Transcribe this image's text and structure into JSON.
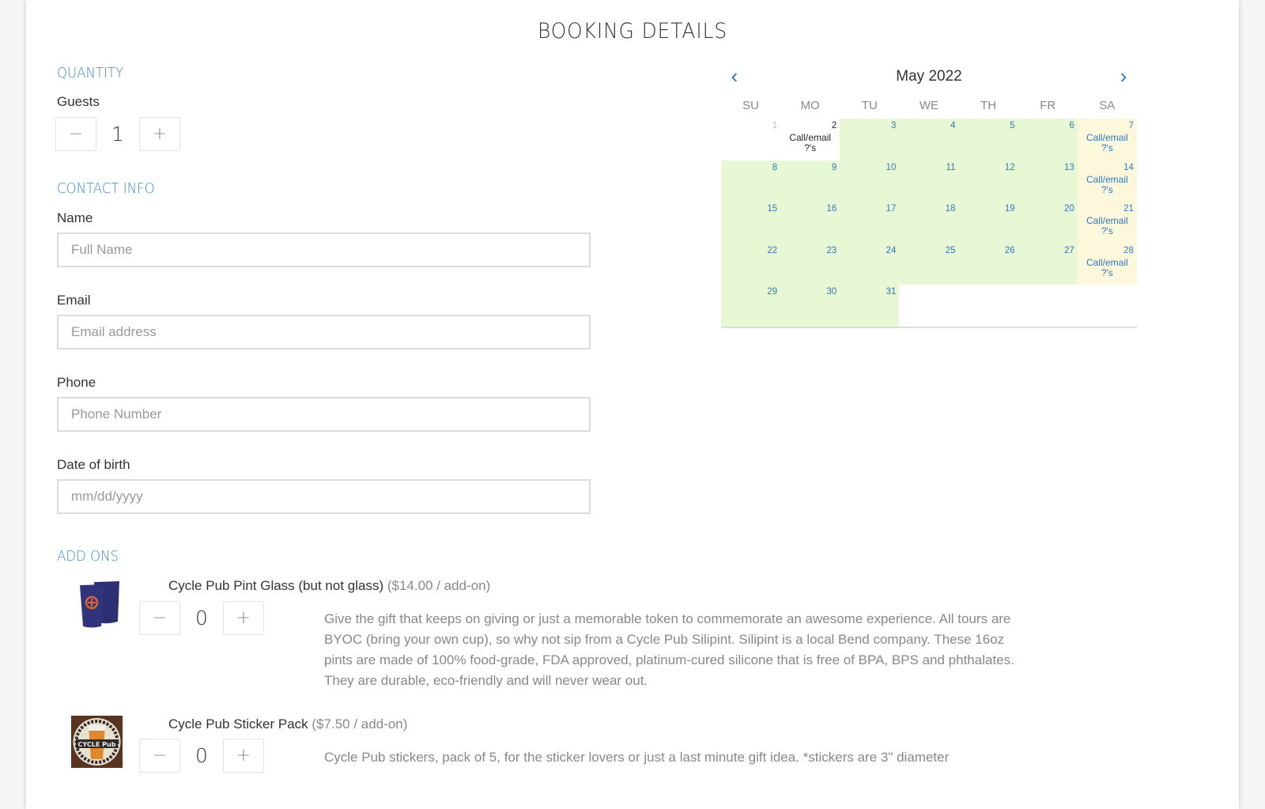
{
  "page": {
    "title": "BOOKING DETAILS"
  },
  "quantity": {
    "heading": "QUANTITY",
    "guests_label": "Guests",
    "guests_value": "1",
    "minus": "−",
    "plus": "+"
  },
  "contact": {
    "heading": "CONTACT INFO",
    "fields": [
      {
        "label": "Name",
        "placeholder": "Full Name",
        "value": ""
      },
      {
        "label": "Email",
        "placeholder": "Email address",
        "value": ""
      },
      {
        "label": "Phone",
        "placeholder": "Phone Number",
        "value": ""
      },
      {
        "label": "Date of birth",
        "placeholder": "mm/dd/yyyy",
        "value": ""
      }
    ]
  },
  "calendar": {
    "month_label": "May 2022",
    "prev_icon": "chevron-left-icon",
    "next_icon": "chevron-right-icon",
    "prev_glyph": "‹",
    "next_glyph": "›",
    "weekdays": [
      "SU",
      "MO",
      "TU",
      "WE",
      "TH",
      "FR",
      "SA"
    ],
    "note_text": "Call/email ?'s",
    "colors": {
      "available": "#e8f7d4",
      "call": "#fdf8dc",
      "link": "#2a7ac4"
    },
    "days": [
      {
        "day": "1",
        "status": "past"
      },
      {
        "day": "2",
        "status": "today",
        "note": "Call/email ?'s"
      },
      {
        "day": "3",
        "status": "avail"
      },
      {
        "day": "4",
        "status": "avail"
      },
      {
        "day": "5",
        "status": "avail"
      },
      {
        "day": "6",
        "status": "avail"
      },
      {
        "day": "7",
        "status": "call",
        "note": "Call/email ?'s"
      },
      {
        "day": "8",
        "status": "avail"
      },
      {
        "day": "9",
        "status": "avail"
      },
      {
        "day": "10",
        "status": "avail"
      },
      {
        "day": "11",
        "status": "avail"
      },
      {
        "day": "12",
        "status": "avail"
      },
      {
        "day": "13",
        "status": "avail"
      },
      {
        "day": "14",
        "status": "call",
        "note": "Call/email ?'s"
      },
      {
        "day": "15",
        "status": "avail"
      },
      {
        "day": "16",
        "status": "avail"
      },
      {
        "day": "17",
        "status": "avail"
      },
      {
        "day": "18",
        "status": "avail"
      },
      {
        "day": "19",
        "status": "avail"
      },
      {
        "day": "20",
        "status": "avail"
      },
      {
        "day": "21",
        "status": "call",
        "note": "Call/email ?'s"
      },
      {
        "day": "22",
        "status": "avail"
      },
      {
        "day": "23",
        "status": "avail"
      },
      {
        "day": "24",
        "status": "avail"
      },
      {
        "day": "25",
        "status": "avail"
      },
      {
        "day": "26",
        "status": "avail"
      },
      {
        "day": "27",
        "status": "avail"
      },
      {
        "day": "28",
        "status": "call",
        "note": "Call/email ?'s"
      },
      {
        "day": "29",
        "status": "avail"
      },
      {
        "day": "30",
        "status": "avail"
      },
      {
        "day": "31",
        "status": "avail"
      }
    ]
  },
  "addons": {
    "heading": "ADD ONS",
    "items": [
      {
        "name": "Cycle Pub Pint Glass (but not glass)",
        "price": "($14.00 / add-on)",
        "quantity": "0",
        "image": "pint-cups-image",
        "description": "Give the gift that keeps on giving or just a memorable token to commemorate an awesome experience. All tours are BYOC (bring your own cup), so why not sip from a Cycle Pub Silipint. Silipint is a local Bend company. These 16oz pints are made of 100% food-grade, FDA approved, platinum-cured silicone that is free of BPA, BPS and phthalates. They are durable, eco-friendly and will never wear out."
      },
      {
        "name": "Cycle Pub Sticker Pack",
        "price": "($7.50 / add-on)",
        "quantity": "0",
        "image": "sticker-image",
        "sticker_text": "CYCLE Pub",
        "description": "Cycle Pub stickers, pack of 5, for the sticker lovers or just a last minute gift idea. *stickers are 3\" diameter"
      }
    ]
  },
  "theme": {
    "accent": "#3a8ad0",
    "page_bg": "#f5f5f5"
  }
}
